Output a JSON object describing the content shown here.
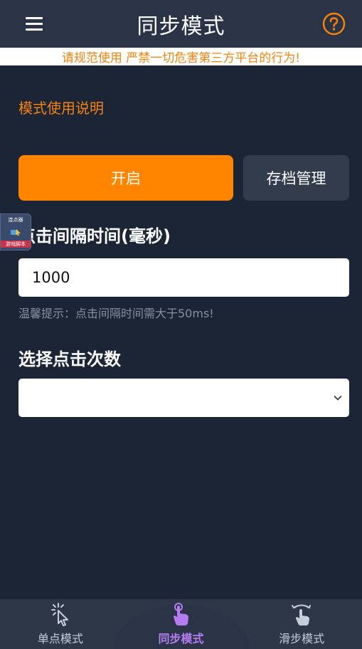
{
  "header": {
    "title": "同步模式",
    "menu_icon": "hamburger-menu-icon",
    "help_icon": "question-circle-icon",
    "accent": "#f5810e"
  },
  "notice": {
    "text": "请规范使用 严禁一切危害第三方平台的行为!"
  },
  "main": {
    "instructions_link": "模式使用说明",
    "start_button": "开启",
    "archive_button": "存档管理",
    "interval_label": "点击间隔时间(毫秒)",
    "interval_value": "1000",
    "tip": "温馨提示：点击间隔时间需大于50ms!",
    "count_label": "选择点击次数",
    "count_selected": ""
  },
  "float_widget": {
    "top_text": "连点器",
    "bottom_text": "游戏脚本"
  },
  "tabbar": {
    "items": [
      {
        "label": "单点模式",
        "icon": "tap-sparkle-icon",
        "active": false
      },
      {
        "label": "同步模式",
        "icon": "finger-tap-icon",
        "active": true
      },
      {
        "label": "滑步模式",
        "icon": "finger-swipe-icon",
        "active": false
      }
    ]
  },
  "colors": {
    "background": "#1b2536",
    "header": "#2a3446",
    "primary_button": "#ff8400",
    "active_tab": "#b47cf0"
  }
}
